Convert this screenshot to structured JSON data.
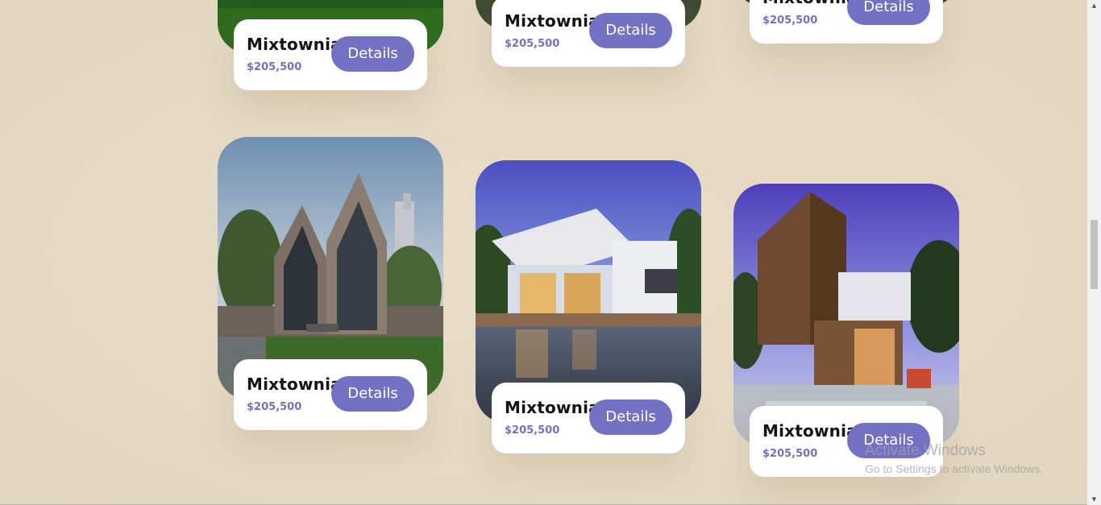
{
  "cards": [
    {
      "name": "Mixtownia",
      "price": "$205,500",
      "button": "Details"
    },
    {
      "name": "Mixtownia",
      "price": "$205,500",
      "button": "Details"
    },
    {
      "name": "Mixtownia",
      "price": "$205,500",
      "button": "Details"
    },
    {
      "name": "Mixtownia",
      "price": "$205,500",
      "button": "Details"
    },
    {
      "name": "Mixtownia",
      "price": "$205,500",
      "button": "Details"
    },
    {
      "name": "Mixtownia",
      "price": "$205,500",
      "button": "Details"
    }
  ],
  "watermark": {
    "title": "Activate Windows",
    "subtitle": "Go to Settings to activate Windows."
  },
  "colors": {
    "background": "#e6dcc6",
    "accent": "#7470c4",
    "price": "#7571c1"
  }
}
